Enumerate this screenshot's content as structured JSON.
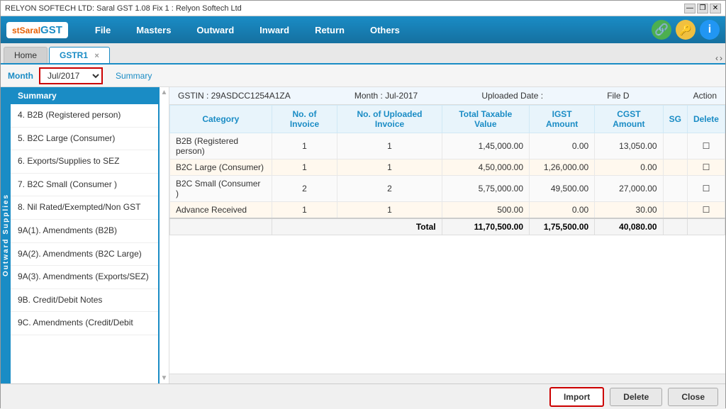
{
  "titlebar": {
    "title": "RELYON SOFTECH LTD: Saral GST  1.08 Fix 1 : Relyon Softech Ltd",
    "minimize": "—",
    "restore": "❐",
    "close": "✕"
  },
  "menubar": {
    "logo": "SaralGST",
    "items": [
      "File",
      "Masters",
      "Outward",
      "Inward",
      "Return",
      "Others"
    ],
    "icons": {
      "network": "🔗",
      "key": "🔑",
      "info": "i"
    }
  },
  "tabs": {
    "home": "Home",
    "gstr1": "GSTR1",
    "nav_prev": "‹",
    "nav_next": "›"
  },
  "monthbar": {
    "label": "Month",
    "value": "Jul/2017",
    "summary": "Summary"
  },
  "sidebar": {
    "title": "Summary",
    "vertical_label": "Outward Supplies",
    "items": [
      {
        "id": "b2b",
        "label": "4. B2B (Registered person)",
        "active": false
      },
      {
        "id": "b2c-large",
        "label": "5. B2C Large (Consumer)",
        "active": false
      },
      {
        "id": "exports",
        "label": "6. Exports/Supplies to SEZ",
        "active": false
      },
      {
        "id": "b2c-small",
        "label": "7. B2C Small (Consumer )",
        "active": false
      },
      {
        "id": "nil-rated",
        "label": "8. Nil Rated/Exempted/Non GST",
        "active": false
      },
      {
        "id": "9a1",
        "label": "9A(1). Amendments (B2B)",
        "active": false
      },
      {
        "id": "9a2",
        "label": "9A(2). Amendments (B2C Large)",
        "active": false
      },
      {
        "id": "9a3",
        "label": "9A(3). Amendments (Exports/SEZ)",
        "active": false
      },
      {
        "id": "9b-credit",
        "label": "9B. Credit/Debit Notes",
        "active": false
      },
      {
        "id": "9c-amend",
        "label": "9C. Amendments (Credit/Debit",
        "active": false
      }
    ]
  },
  "table": {
    "gstin_label": "GSTIN : 29ASDCC1254A1ZA",
    "month_label": "Month : Jul-2017",
    "uploaded_label": "Uploaded Date :",
    "file_d_label": "File D",
    "action_label": "Action",
    "columns": [
      "Category",
      "No. of Invoice",
      "No. of Uploaded Invoice",
      "Total Taxable Value",
      "IGST Amount",
      "CGST Amount",
      "SG",
      "Delete"
    ],
    "rows": [
      {
        "category": "B2B (Registered person)",
        "no_invoice": "1",
        "no_uploaded": "1",
        "total_taxable": "1,45,000.00",
        "igst": "0.00",
        "cgst": "13,050.00",
        "sg": "",
        "delete": "☐"
      },
      {
        "category": "B2C Large (Consumer)",
        "no_invoice": "1",
        "no_uploaded": "1",
        "total_taxable": "4,50,000.00",
        "igst": "1,26,000.00",
        "cgst": "0.00",
        "sg": "",
        "delete": "☐"
      },
      {
        "category": "B2C Small (Consumer )",
        "no_invoice": "2",
        "no_uploaded": "2",
        "total_taxable": "5,75,000.00",
        "igst": "49,500.00",
        "cgst": "27,000.00",
        "sg": "",
        "delete": "☐"
      },
      {
        "category": "Advance Received",
        "no_invoice": "1",
        "no_uploaded": "1",
        "total_taxable": "500.00",
        "igst": "0.00",
        "cgst": "30.00",
        "sg": "",
        "delete": "☐"
      }
    ],
    "total": {
      "label": "Total",
      "total_taxable": "11,70,500.00",
      "igst": "1,75,500.00",
      "cgst": "40,080.00"
    }
  },
  "buttons": {
    "import": "Import",
    "delete": "Delete",
    "close": "Close"
  }
}
